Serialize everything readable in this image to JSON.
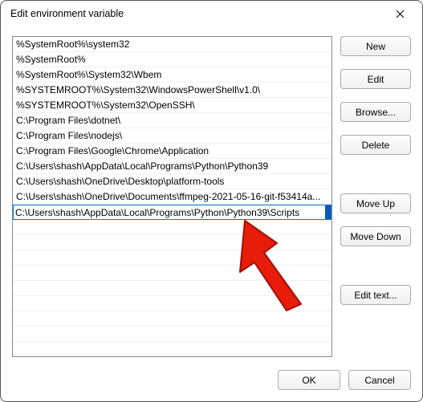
{
  "window": {
    "title": "Edit environment variable"
  },
  "list": {
    "items": [
      "%SystemRoot%\\system32",
      "%SystemRoot%",
      "%SystemRoot%\\System32\\Wbem",
      "%SYSTEMROOT%\\System32\\WindowsPowerShell\\v1.0\\",
      "%SYSTEMROOT%\\System32\\OpenSSH\\",
      "C:\\Program Files\\dotnet\\",
      "C:\\Program Files\\nodejs\\",
      "C:\\Program Files\\Google\\Chrome\\Application",
      "C:\\Users\\shash\\AppData\\Local\\Programs\\Python\\Python39",
      "C:\\Users\\shash\\OneDrive\\Desktop\\platform-tools",
      "C:\\Users\\shash\\OneDrive\\Documents\\ffmpeg-2021-05-16-git-f53414a..."
    ],
    "editing_value": "C:\\Users\\shash\\AppData\\Local\\Programs\\Python\\Python39\\Scripts"
  },
  "buttons": {
    "new": "New",
    "edit": "Edit",
    "browse": "Browse...",
    "delete": "Delete",
    "move_up": "Move Up",
    "move_down": "Move Down",
    "edit_text": "Edit text...",
    "ok": "OK",
    "cancel": "Cancel"
  }
}
